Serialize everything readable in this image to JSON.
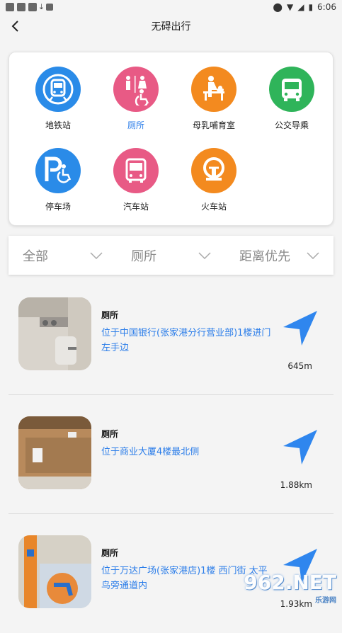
{
  "status_bar": {
    "time": "6:06"
  },
  "app_bar": {
    "title": "无碍出行"
  },
  "categories": [
    {
      "label": "地铁站",
      "color": "#2a8be8",
      "icon": "metro-icon",
      "active": false
    },
    {
      "label": "厕所",
      "color": "#e85a85",
      "icon": "toilet-icon",
      "active": true
    },
    {
      "label": "母乳哺育室",
      "color": "#f38a1f",
      "icon": "nursing-room-icon",
      "active": false
    },
    {
      "label": "公交导乘",
      "color": "#2fb45a",
      "icon": "bus-icon",
      "active": false
    },
    {
      "label": "停车场",
      "color": "#2a8be8",
      "icon": "parking-icon",
      "active": false
    },
    {
      "label": "汽车站",
      "color": "#e85a85",
      "icon": "coach-station-icon",
      "active": false
    },
    {
      "label": "火车站",
      "color": "#f38a1f",
      "icon": "train-station-icon",
      "active": false
    }
  ],
  "filters": [
    {
      "label": "全部"
    },
    {
      "label": "厕所"
    },
    {
      "label": "距离优先"
    }
  ],
  "results": [
    {
      "name": "厕所",
      "address": "位于中国银行(张家港分行营业部)1楼进门左手边",
      "distance": "645m"
    },
    {
      "name": "厕所",
      "address": "位于商业大厦4楼最北侧",
      "distance": "1.88km"
    },
    {
      "name": "厕所",
      "address": "位于万达广场(张家港店)1楼 西门街 太平鸟旁通道内",
      "distance": "1.93km"
    }
  ],
  "watermark": {
    "text": "962.NET",
    "sub": "乐游网"
  },
  "colors": {
    "accent": "#2b7de9",
    "nav_arrow": "#2f86ee"
  }
}
